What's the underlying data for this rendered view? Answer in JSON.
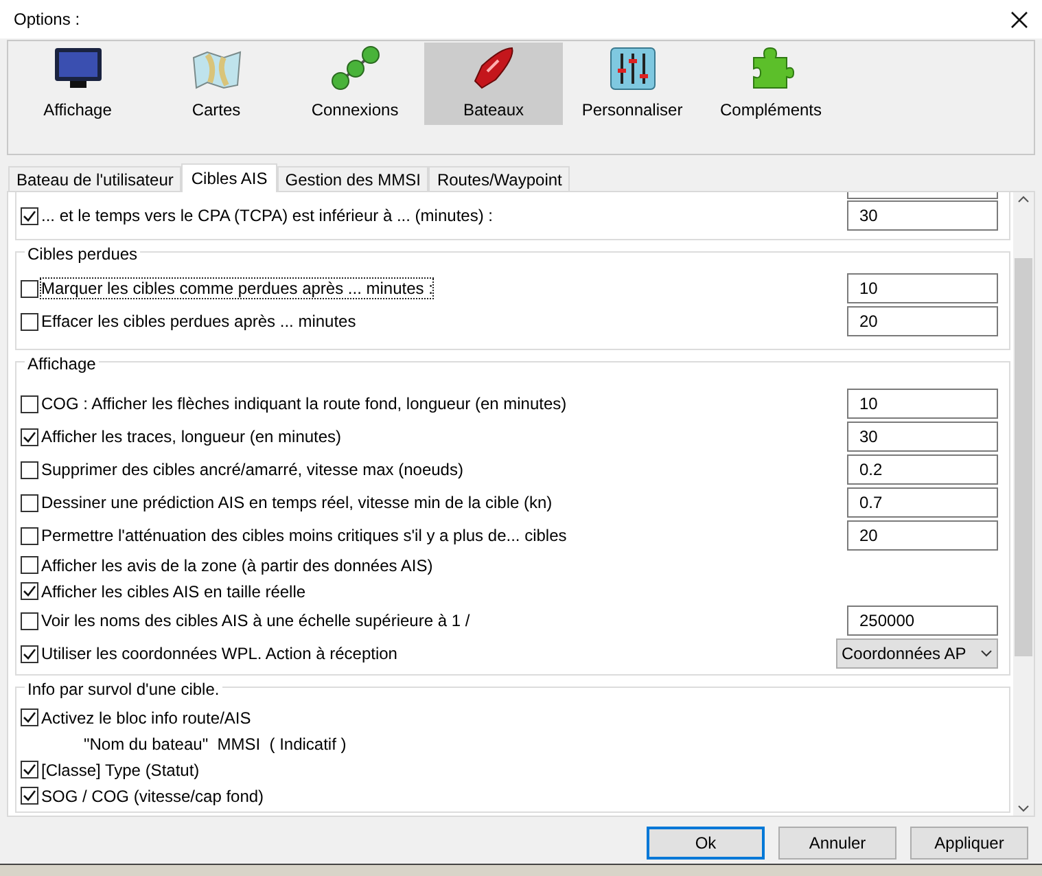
{
  "window": {
    "title": "Options :"
  },
  "categories": [
    {
      "label": "Affichage",
      "selected": false
    },
    {
      "label": "Cartes",
      "selected": false
    },
    {
      "label": "Connexions",
      "selected": false
    },
    {
      "label": "Bateaux",
      "selected": true
    },
    {
      "label": "Personnaliser",
      "selected": false
    },
    {
      "label": "Compléments",
      "selected": false
    }
  ],
  "tabs": [
    {
      "label": "Bateau de l'utilisateur",
      "selected": false
    },
    {
      "label": "Cibles AIS",
      "selected": true
    },
    {
      "label": "Gestion des MMSI",
      "selected": false
    },
    {
      "label": "Routes/Waypoint",
      "selected": false
    }
  ],
  "sections": [
    {
      "rows": [
        {
          "kind": "checkbox",
          "label": "... et le temps vers le CPA (TCPA) est inférieur à ... (minutes) :",
          "checked": true,
          "value": "30"
        }
      ]
    },
    {
      "title": "Cibles perdues",
      "rows": [
        {
          "kind": "checkbox",
          "label": "Marquer les cibles comme perdues après ... minutes :",
          "checked": false,
          "focused": true,
          "value": "10"
        },
        {
          "kind": "checkbox",
          "label": "Effacer les cibles perdues après ... minutes",
          "checked": false,
          "value": "20"
        }
      ]
    },
    {
      "title": "Affichage",
      "rows": [
        {
          "kind": "checkbox",
          "label": "COG : Afficher les flèches indiquant la route fond, longueur (en minutes)",
          "checked": false,
          "value": "10"
        },
        {
          "kind": "checkbox",
          "label": "Afficher les traces, longueur (en minutes)",
          "checked": true,
          "value": "30"
        },
        {
          "kind": "checkbox",
          "label": "Supprimer des cibles ancré/amarré, vitesse max (noeuds)",
          "checked": false,
          "value": "0.2"
        },
        {
          "kind": "checkbox",
          "label": "Dessiner une prédiction AIS en temps réel, vitesse min de la cible (kn)",
          "checked": false,
          "value": "0.7"
        },
        {
          "kind": "checkbox",
          "label": "Permettre l'atténuation des cibles moins critiques s'il y a plus de... cibles",
          "checked": false,
          "value": "20"
        },
        {
          "kind": "checkbox",
          "label": "Afficher les avis de la zone (à partir des données AIS)",
          "checked": false
        },
        {
          "kind": "checkbox",
          "label": "Afficher les cibles AIS en taille réelle",
          "checked": true
        },
        {
          "kind": "checkbox",
          "label": "Voir les noms des cibles AIS à une échelle supérieure à 1 /",
          "checked": false,
          "value": "250000"
        },
        {
          "kind": "checkbox",
          "label": "Utiliser les coordonnées WPL. Action à réception",
          "checked": true,
          "dropdown": "Coordonnées AP"
        }
      ]
    },
    {
      "title": "Info par survol d'une cible.",
      "rows": [
        {
          "kind": "checkbox",
          "label": "Activez le bloc info route/AIS",
          "checked": true
        },
        {
          "kind": "note",
          "label": "\"Nom du bateau\"  MMSI  ( Indicatif )"
        },
        {
          "kind": "checkbox",
          "label": "[Classe] Type (Statut)",
          "checked": true
        },
        {
          "kind": "checkbox",
          "label": "SOG / COG (vitesse/cap fond)",
          "checked": true
        }
      ]
    }
  ],
  "buttons": [
    {
      "label": "Ok",
      "default": true
    },
    {
      "label": "Annuler",
      "default": false
    },
    {
      "label": "Appliquer",
      "default": false
    }
  ]
}
